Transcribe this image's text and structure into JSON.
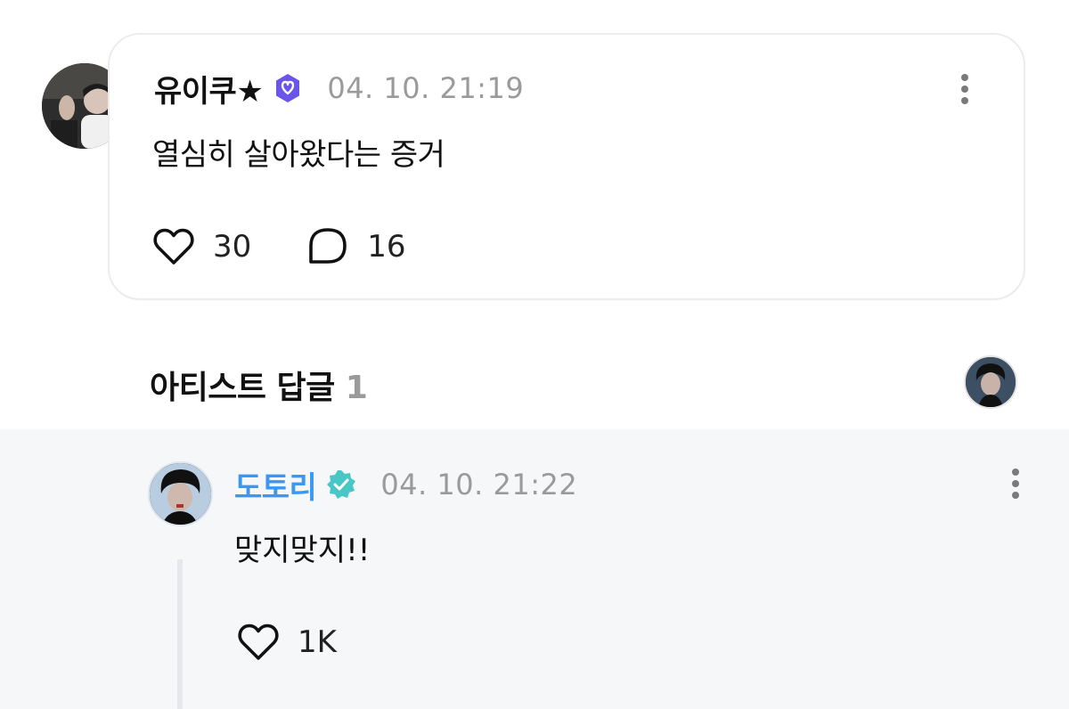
{
  "post": {
    "author": "유이쿠★",
    "timestamp": "04. 10. 21:19",
    "text": "열심히 살아왔다는 증거",
    "likes": "30",
    "comments": "16",
    "badge_color": "#6b55e8"
  },
  "replies_header": {
    "title": "아티스트 답글",
    "count": "1"
  },
  "reply": {
    "author": "도토리",
    "timestamp": "04. 10. 21:22",
    "text": "맞지맞지!!",
    "likes": "1K",
    "author_color": "#3b97ef",
    "badge_color": "#49c7c7"
  }
}
